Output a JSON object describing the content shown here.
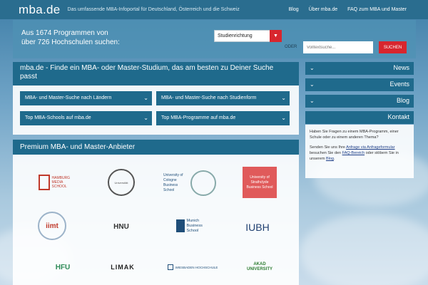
{
  "header": {
    "logo": "mba.de",
    "tagline": "Das umfassende MBA-Infoportal für Deutschland, Österreich und die Schweiz",
    "nav": [
      "Blog",
      "Über mba.de",
      "FAQ zum MBA und Master"
    ]
  },
  "search": {
    "line1": "Aus 1674 Programmen von",
    "line2": "über 726 Hochschulen suchen:",
    "select_value": "Studienrichtung",
    "or_label": "ODER",
    "placeholder": "Volltextsuche...",
    "button": "SUCHEN"
  },
  "main": {
    "title": "mba.de - Finde ein MBA- oder Master-Studium, das am besten zu Deiner Suche passt",
    "dropdowns": [
      "MBA- und Master-Suche nach Ländern",
      "MBA- und Master-Suche nach Studienform",
      "Top MBA-Schools auf mba.de",
      "Top MBA-Programme auf mba.de"
    ]
  },
  "providers": {
    "title": "Premium MBA- und Master-Anbieter",
    "logos": [
      "HAMBURG MEDIA SCHOOL",
      "Universität",
      "University of Cologne Business School",
      "University of Strathclyde Business School",
      "iimt",
      "HNU",
      "Munich Business School",
      "IUBH",
      "HFU",
      "LIMAK",
      "WIESBADEN HOCHSCHULE",
      "AKAD UNIVERSITY"
    ]
  },
  "sidebar": {
    "items": [
      "News",
      "Events",
      "Blog"
    ],
    "kontakt_title": "Kontakt",
    "kontakt_p1": "Haben Sie Fragen zu einem MBA-Programm, einer Schule oder zu einem anderen Thema?",
    "kontakt_p2a": "Senden Sie uns Ihre",
    "kontakt_link1": "Anfrage via Anfrageformular",
    "kontakt_p2b": "besuchen Sie den",
    "kontakt_link2": "FAQ-Bereich",
    "kontakt_p2c": "oder stöbern Sie in unserem",
    "kontakt_link3": "Blog",
    "kontakt_p2d": "."
  },
  "colors": {
    "primary": "#1f6a8c",
    "accent": "#d8262e",
    "topbar": "#2a6d8f"
  }
}
